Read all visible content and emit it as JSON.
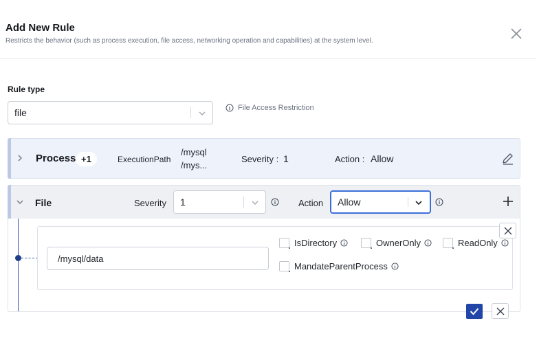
{
  "header": {
    "title": "Add New Rule",
    "subtitle": "Restricts the behavior (such as process execution, file access, networking operation and capabilities) at the system level."
  },
  "rule_type": {
    "label": "Rule type",
    "value": "file",
    "info_text": "File Access Restriction"
  },
  "process": {
    "name": "Process",
    "badge": "+1",
    "path_label": "ExecutionPath",
    "path_lines": [
      "/mysql",
      "/mys..."
    ],
    "severity_label": "Severity :",
    "severity_value": "1",
    "action_label": "Action :",
    "action_value": "Allow"
  },
  "file": {
    "name": "File",
    "severity_label": "Severity",
    "severity_value": "1",
    "action_label": "Action",
    "action_value": "Allow",
    "path_value": "/mysql/data",
    "checkboxes": {
      "is_directory": "IsDirectory",
      "owner_only": "OwnerOnly",
      "read_only": "ReadOnly",
      "mandate_parent": "MandateParentProcess"
    }
  },
  "colors": {
    "accent": "#2146a8",
    "focus_border": "#3b6fd8",
    "process_bg": "#eef2fb",
    "file_bg": "#eef0f4"
  },
  "icons": [
    "close-icon",
    "chevron-down-icon",
    "info-icon",
    "chevron-right-icon",
    "edit-icon",
    "plus-icon",
    "check-icon"
  ]
}
